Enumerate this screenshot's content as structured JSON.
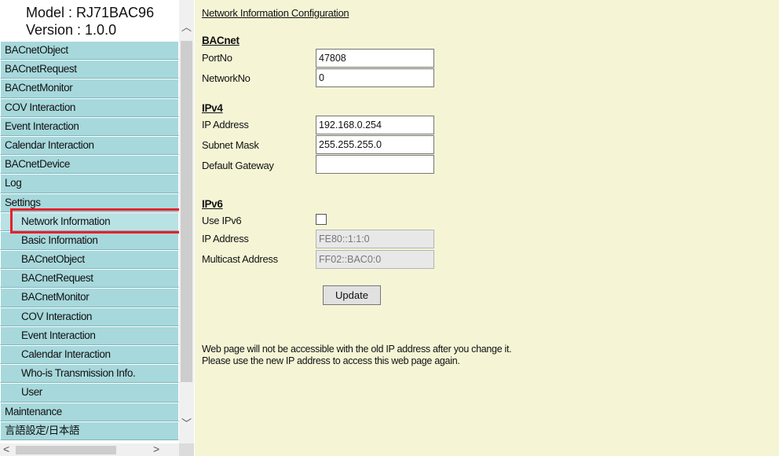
{
  "header": {
    "model": "Model : RJ71BAC96",
    "version": "Version : 1.0.0"
  },
  "menu": [
    {
      "label": "BACnetObject",
      "level": "top"
    },
    {
      "label": "BACnetRequest",
      "level": "top"
    },
    {
      "label": "BACnetMonitor",
      "level": "top"
    },
    {
      "label": "COV Interaction",
      "level": "top"
    },
    {
      "label": "Event Interaction",
      "level": "top"
    },
    {
      "label": "Calendar Interaction",
      "level": "top"
    },
    {
      "label": "BACnetDevice",
      "level": "top"
    },
    {
      "label": "Log",
      "level": "top"
    },
    {
      "label": "Settings",
      "level": "top"
    },
    {
      "label": "Network Information",
      "level": "sub",
      "selected": true
    },
    {
      "label": "Basic Information",
      "level": "sub"
    },
    {
      "label": "BACnetObject",
      "level": "sub"
    },
    {
      "label": "BACnetRequest",
      "level": "sub"
    },
    {
      "label": "BACnetMonitor",
      "level": "sub"
    },
    {
      "label": "COV Interaction",
      "level": "sub"
    },
    {
      "label": "Event Interaction",
      "level": "sub"
    },
    {
      "label": "Calendar Interaction",
      "level": "sub"
    },
    {
      "label": "Who-is Transmission Info.",
      "level": "sub"
    },
    {
      "label": "User",
      "level": "sub"
    },
    {
      "label": "Maintenance",
      "level": "top"
    },
    {
      "label": "言語設定/日本語",
      "level": "top"
    }
  ],
  "form": {
    "title": "Network Information Configuration",
    "bacnet": {
      "heading": "BACnet",
      "port_label": "PortNo",
      "port_value": "47808",
      "network_label": "NetworkNo",
      "network_value": "0"
    },
    "ipv4": {
      "heading": "IPv4",
      "ip_label": "IP Address",
      "ip_value": "192.168.0.254",
      "subnet_label": "Subnet Mask",
      "subnet_value": "255.255.255.0",
      "gateway_label": "Default Gateway",
      "gateway_value": ""
    },
    "ipv6": {
      "heading": "IPv6",
      "use_label": "Use IPv6",
      "ip_label": "IP Address",
      "ip_value": "FE80::1:1:0",
      "multicast_label": "Multicast Address",
      "multicast_value": "FF02::BAC0:0"
    },
    "update_label": "Update",
    "note_line1": "Web page will not be accessible with the old IP address after you change it.",
    "note_line2": "Please use the new IP address to access this web page again."
  },
  "colors": {
    "menu_bg": "#a7d8dc",
    "content_bg": "#f5f5d6",
    "highlight": "#e8202a"
  }
}
